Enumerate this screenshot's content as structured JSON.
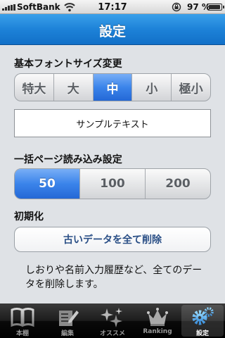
{
  "status_bar": {
    "carrier": "SoftBank",
    "time": "17:17",
    "battery_percent": "97 %",
    "battery_level": 0.97
  },
  "nav": {
    "title": "設定"
  },
  "font_size": {
    "label": "基本フォントサイズ変更",
    "options": [
      "特大",
      "大",
      "中",
      "小",
      "極小"
    ],
    "selected": "中"
  },
  "sample": {
    "text": "サンプルテキスト"
  },
  "page_load": {
    "label": "一括ページ読み込み設定",
    "options": [
      "50",
      "100",
      "200"
    ],
    "selected": "50"
  },
  "reset": {
    "label": "初期化",
    "button_label": "古いデータを全て削除",
    "description": "しおりや名前入力履歴など、全てのデータを削除します。"
  },
  "tabs": [
    {
      "label": "本棚",
      "icon": "book-icon"
    },
    {
      "label": "編集",
      "icon": "edit-icon"
    },
    {
      "label": "オススメ",
      "icon": "sparkle-icon"
    },
    {
      "label": "Ranking",
      "icon": "crown-icon"
    },
    {
      "label": "設定",
      "icon": "gear-icon",
      "active": true
    }
  ],
  "colors": {
    "nav_blue": "#1d82d8",
    "segment_selected": "#3b84ea",
    "button_text": "#2a4f86",
    "tab_bar": "#1c1c1c"
  }
}
